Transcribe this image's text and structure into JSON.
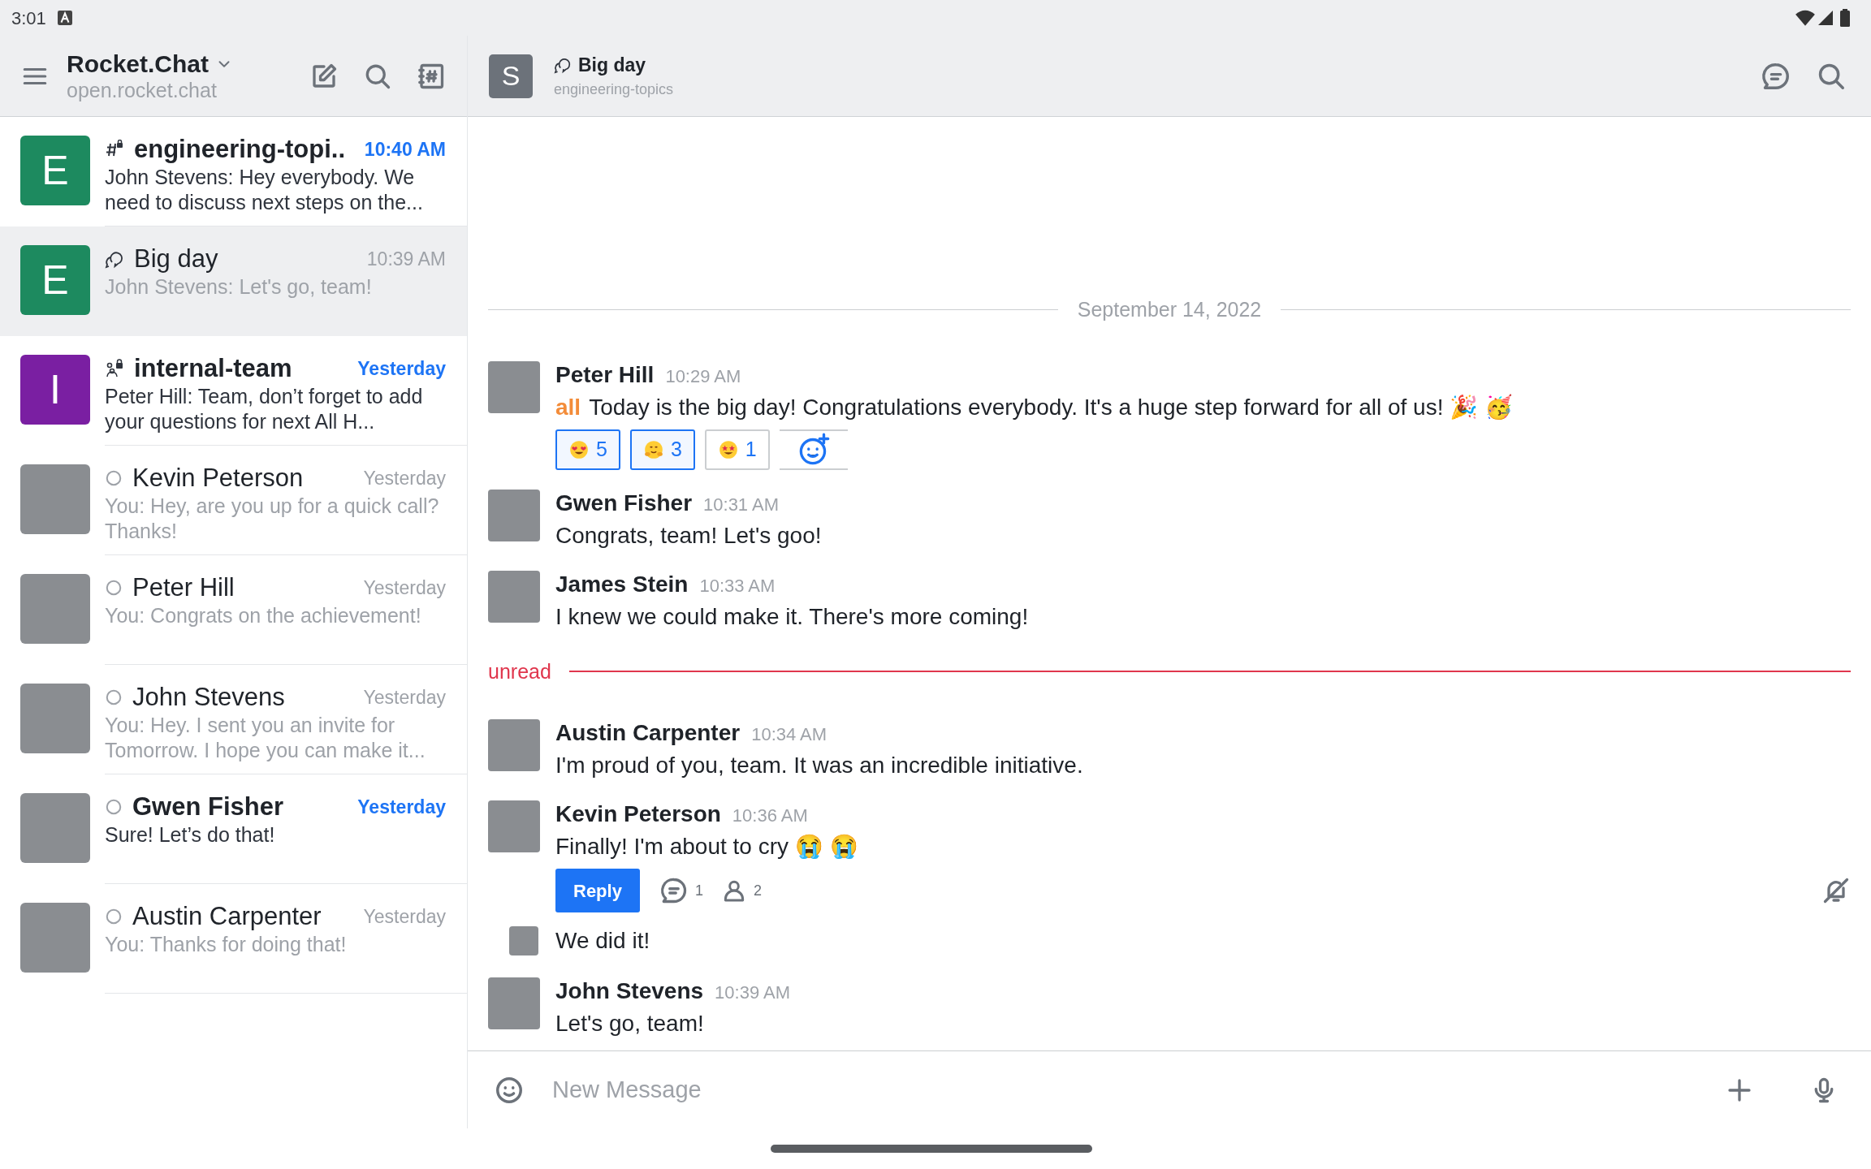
{
  "status_bar": {
    "time": "3:01"
  },
  "sidebar": {
    "workspace_name": "Rocket.Chat",
    "workspace_url": "open.rocket.chat",
    "rooms": [
      {
        "kind": "channel",
        "avatar_letter": "E",
        "color": "#1d8a5f",
        "name": "engineering-topi..",
        "time": "10:40 AM",
        "preview": "John Stevens: Hey everybody. We need to discuss next steps on the...",
        "unread": true,
        "selected": false
      },
      {
        "kind": "discussion",
        "avatar_letter": "E",
        "color": "#1d8a5f",
        "name": "Big day",
        "time": "10:39 AM",
        "preview": "John Stevens: Let's go, team!",
        "unread": false,
        "selected": true
      },
      {
        "kind": "team",
        "avatar_letter": "I",
        "color": "#7a1fa2",
        "name": "internal-team",
        "time": "Yesterday",
        "preview": "Peter Hill: Team, don’t forget to add your questions for next All H...",
        "unread": true,
        "selected": false
      },
      {
        "kind": "direct",
        "name": "Kevin Peterson",
        "time": "Yesterday",
        "preview": "You: Hey, are you up for a quick call? Thanks!",
        "unread": false,
        "selected": false
      },
      {
        "kind": "direct",
        "name": "Peter Hill",
        "time": "Yesterday",
        "preview": "You: Congrats on the achievement!",
        "unread": false,
        "selected": false
      },
      {
        "kind": "direct",
        "name": "John Stevens",
        "time": "Yesterday",
        "preview": "You: Hey. I sent you an invite for Tomorrow. I hope you can make it...",
        "unread": false,
        "selected": false
      },
      {
        "kind": "direct",
        "name": "Gwen Fisher",
        "time": "Yesterday",
        "preview": "Sure! Let’s do that!",
        "unread": true,
        "selected": false
      },
      {
        "kind": "direct",
        "name": "Austin Carpenter",
        "time": "Yesterday",
        "preview": "You: Thanks for doing that!",
        "unread": false,
        "selected": false
      }
    ]
  },
  "chat": {
    "header": {
      "avatar_letter": "S",
      "title": "Big day",
      "subtitle": "engineering-topics"
    },
    "items": [
      {
        "kind": "date",
        "label": "September 14, 2022"
      },
      {
        "kind": "message",
        "author": "Peter Hill",
        "time": "10:29 AM",
        "mention": "all",
        "text": "Today is the big day! Congratulations everybody. It's a huge step forward for all of us! 🎉 🥳",
        "reactions": [
          {
            "kind": "heart-eyes",
            "count": "5",
            "selected": true
          },
          {
            "kind": "hugging",
            "count": "3",
            "selected": true
          },
          {
            "kind": "star-struck",
            "count": "1",
            "selected": false
          }
        ]
      },
      {
        "kind": "message",
        "author": "Gwen Fisher",
        "time": "10:31 AM",
        "text": "Congrats, team! Let's goo!"
      },
      {
        "kind": "message",
        "author": "James Stein",
        "time": "10:33 AM",
        "text": "I knew we could make it. There's more coming!"
      },
      {
        "kind": "unread",
        "label": "unread"
      },
      {
        "kind": "message",
        "author": "Austin Carpenter",
        "time": "10:34 AM",
        "text": "I'm proud of you, team. It was an incredible initiative."
      },
      {
        "kind": "message",
        "author": "Kevin Peterson",
        "time": "10:36 AM",
        "text": "Finally! I'm about to cry 😭 😭",
        "thread": {
          "button": "Reply",
          "replies": "1",
          "participants": "2"
        }
      },
      {
        "kind": "followup",
        "text": "We did it!"
      },
      {
        "kind": "message",
        "author": "John Stevens",
        "time": "10:39 AM",
        "text": "Let's go, team!"
      }
    ],
    "composer": {
      "placeholder": "New Message"
    }
  }
}
